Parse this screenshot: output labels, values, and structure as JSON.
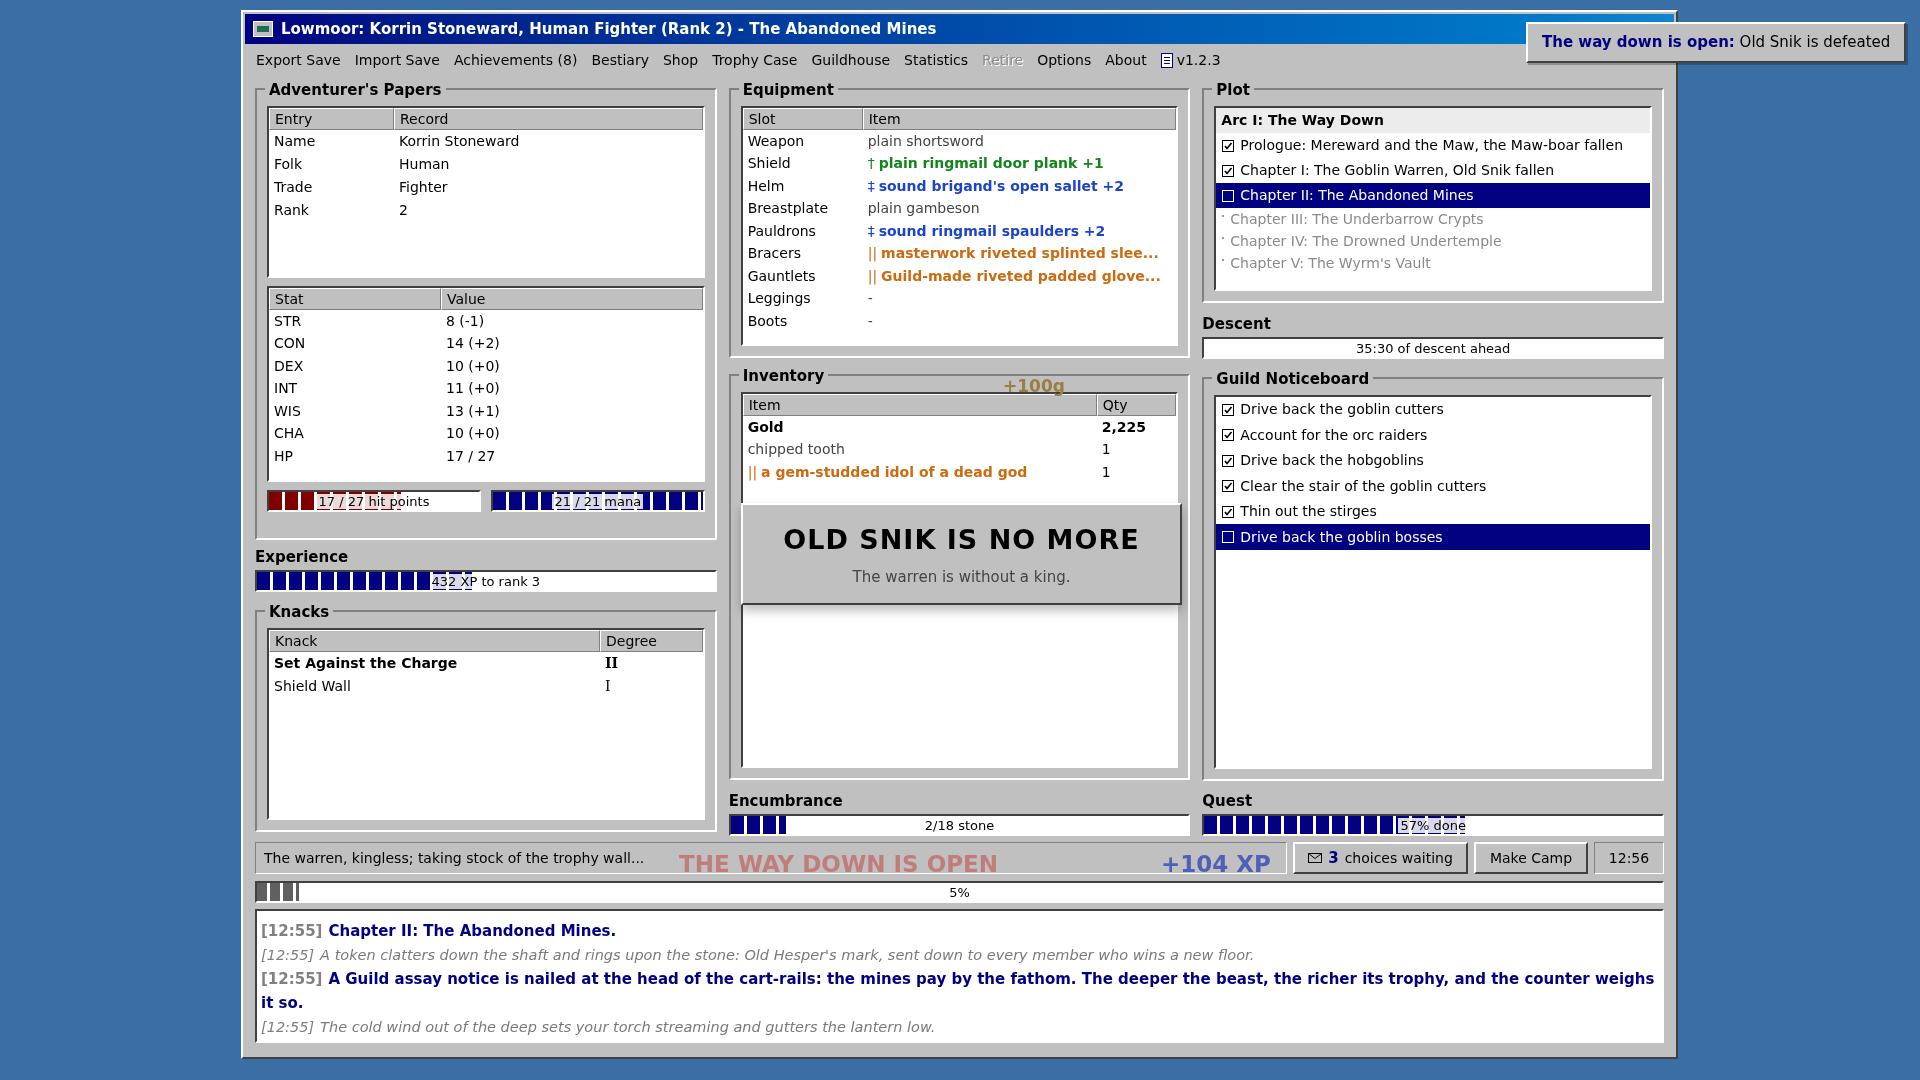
{
  "window": {
    "title": "Lowmoor: Korrin Stoneward, Human Fighter (Rank 2) - The Abandoned Mines"
  },
  "menu": [
    {
      "kind": "item",
      "label": "Export Save",
      "disabled": false
    },
    {
      "kind": "item",
      "label": "Import Save",
      "disabled": false
    },
    {
      "kind": "item",
      "label": "Achievements (8)",
      "disabled": false
    },
    {
      "kind": "item",
      "label": "Bestiary",
      "disabled": false
    },
    {
      "kind": "item",
      "label": "Shop",
      "disabled": false
    },
    {
      "kind": "item",
      "label": "Trophy Case",
      "disabled": false
    },
    {
      "kind": "item",
      "label": "Guildhouse",
      "disabled": false
    },
    {
      "kind": "item",
      "label": "Statistics",
      "disabled": false
    },
    {
      "kind": "item",
      "label": "Retire",
      "disabled": true
    },
    {
      "kind": "item",
      "label": "Options",
      "disabled": false
    },
    {
      "kind": "item",
      "label": "About",
      "disabled": false
    },
    {
      "kind": "version",
      "label": "v1.2.3",
      "disabled": false
    }
  ],
  "toast": {
    "title": "The way down is open:",
    "text": "Old Snik is defeated"
  },
  "papers": {
    "title": "Adventurer's Papers",
    "columns": [
      "Entry",
      "Record"
    ],
    "rows": [
      [
        "Name",
        "Korrin Stoneward"
      ],
      [
        "Folk",
        "Human"
      ],
      [
        "Trade",
        "Fighter"
      ],
      [
        "Rank",
        "2"
      ]
    ],
    "stat_columns": [
      "Stat",
      "Value"
    ],
    "stats": [
      [
        "STR",
        "8 (-1)"
      ],
      [
        "CON",
        "14 (+2)"
      ],
      [
        "DEX",
        "10 (+0)"
      ],
      [
        "INT",
        "11 (+0)"
      ],
      [
        "WIS",
        "13 (+1)"
      ],
      [
        "CHA",
        "10 (+0)"
      ],
      [
        "HP",
        "17 / 27"
      ]
    ],
    "hp_bar": {
      "level": 0.63,
      "reading": "17 / 27 hit points"
    },
    "mana_bar": {
      "level": 1,
      "reading": "21 / 21 mana"
    }
  },
  "experience": {
    "title": "Experience",
    "level": 0.47,
    "reading": "432 XP to rank 3"
  },
  "knacks": {
    "title": "Knacks",
    "columns": [
      "Knack",
      "Degree"
    ],
    "rows": [
      {
        "name": "Set Against the Charge",
        "degree": "II",
        "bold": true
      },
      {
        "name": "Shield Wall",
        "degree": "I",
        "bold": false
      }
    ]
  },
  "equipment": {
    "title": "Equipment",
    "columns": [
      "Slot",
      "Item"
    ],
    "rows": [
      {
        "slot": "Weapon",
        "item": "plain shortsword",
        "color": "#444444",
        "bold": false
      },
      {
        "slot": "Shield",
        "mark": "†",
        "item": "plain ringmail door plank +1",
        "color": "#12861b",
        "bold": true
      },
      {
        "slot": "Helm",
        "mark": "‡",
        "item": "sound brigand's open sallet +2",
        "color": "#1d44c8",
        "bold": true
      },
      {
        "slot": "Breastplate",
        "item": "plain gambeson",
        "color": "#444444",
        "bold": false
      },
      {
        "slot": "Pauldrons",
        "mark": "‡",
        "item": "sound ringmail spaulders +2",
        "color": "#1d44c8",
        "bold": true
      },
      {
        "slot": "Bracers",
        "mark": "||",
        "item": "masterwork riveted splinted slee...",
        "color": "#cc6a10",
        "bold": true
      },
      {
        "slot": "Gauntlets",
        "mark": "||",
        "item": "Guild-made riveted padded glove...",
        "color": "#cc6a10",
        "bold": true
      },
      {
        "slot": "Leggings",
        "item": "-",
        "color": "#444444",
        "bold": false
      },
      {
        "slot": "Boots",
        "item": "-",
        "color": "#444444",
        "bold": false
      }
    ]
  },
  "inventory": {
    "title": "Inventory",
    "columns": [
      "Item",
      "Qty"
    ],
    "rows": [
      {
        "item": "Gold",
        "qty": "2,225",
        "color": "#000000",
        "bold": true
      },
      {
        "item": "chipped tooth",
        "qty": "1",
        "color": "#444444",
        "bold": false
      },
      {
        "mark": "||",
        "item": "a gem-studded idol of a dead god",
        "qty": "1",
        "color": "#cc6a10",
        "bold": true
      }
    ]
  },
  "popup": {
    "title": "OLD SNIK IS NO MORE",
    "text": "The warren is without a king."
  },
  "floaters": [
    {
      "kind": "gold",
      "text": "+100g"
    },
    {
      "kind": "banner",
      "text": "THE WAY DOWN IS OPEN"
    },
    {
      "kind": "xp",
      "text": "+104 XP"
    }
  ],
  "encumbrance": {
    "title": "Encumbrance",
    "level": 0.12,
    "reading": "2/18 stone"
  },
  "plot": {
    "title": "Plot",
    "items": [
      {
        "kind": "arc",
        "label": "Arc I: The Way Down",
        "selected": false
      },
      {
        "kind": "chapter",
        "label": "Prologue: Mereward and the Maw, the Maw-boar fallen",
        "checked": true,
        "selected": false
      },
      {
        "kind": "chapter",
        "label": "Chapter I: The Goblin Warren, Old Snik fallen",
        "checked": true,
        "selected": false
      },
      {
        "kind": "chapter",
        "label": "Chapter II: The Abandoned Mines",
        "checked": false,
        "selected": true
      },
      {
        "kind": "future",
        "label": "Chapter III: The Underbarrow Crypts",
        "selected": false
      },
      {
        "kind": "future",
        "label": "Chapter IV: The Drowned Undertemple",
        "selected": false
      },
      {
        "kind": "future",
        "label": "Chapter V: The Wyrm's Vault",
        "selected": false
      }
    ]
  },
  "descent": {
    "title": "Descent",
    "level": 0,
    "reading": "35:30 of descent ahead"
  },
  "noticeboard": {
    "title": "Guild Noticeboard",
    "items": [
      {
        "label": "Drive back the goblin cutters",
        "checked": true,
        "selected": false
      },
      {
        "label": "Account for the orc raiders",
        "checked": true,
        "selected": false
      },
      {
        "label": "Drive back the hobgoblins",
        "checked": true,
        "selected": false
      },
      {
        "label": "Clear the stair of the goblin cutters",
        "checked": true,
        "selected": false
      },
      {
        "label": "Thin out the stirges",
        "checked": true,
        "selected": false
      },
      {
        "label": "Drive back the goblin bosses",
        "checked": false,
        "selected": true
      }
    ]
  },
  "quest": {
    "title": "Quest",
    "level": 0.57,
    "reading": "57% done"
  },
  "status_bar": {
    "text": "The warren, kingless; taking stock of the trophy wall...",
    "choices_count": "3",
    "choices_label": "choices waiting",
    "camp_button": "Make Camp",
    "clock": "12:56"
  },
  "task_progress": {
    "level": 0.03,
    "reading": "5%"
  },
  "log": [
    {
      "kind": "headline",
      "time": "[12:55]",
      "text": "Chapter II: The Abandoned Mines."
    },
    {
      "kind": "flavor",
      "time": "[12:55]",
      "text": "A token clatters down the shaft and rings upon the stone: Old Hesper's mark, sent down to every member who wins a new floor."
    },
    {
      "kind": "headline",
      "time": "[12:55]",
      "text": "A Guild assay notice is nailed at the head of the cart-rails: the mines pay by the fathom. The deeper the beast, the richer its trophy, and the counter weighs it so."
    },
    {
      "kind": "flavor",
      "time": "[12:55]",
      "text": "The cold wind out of the deep sets your torch streaming and gutters the lantern low."
    }
  ]
}
